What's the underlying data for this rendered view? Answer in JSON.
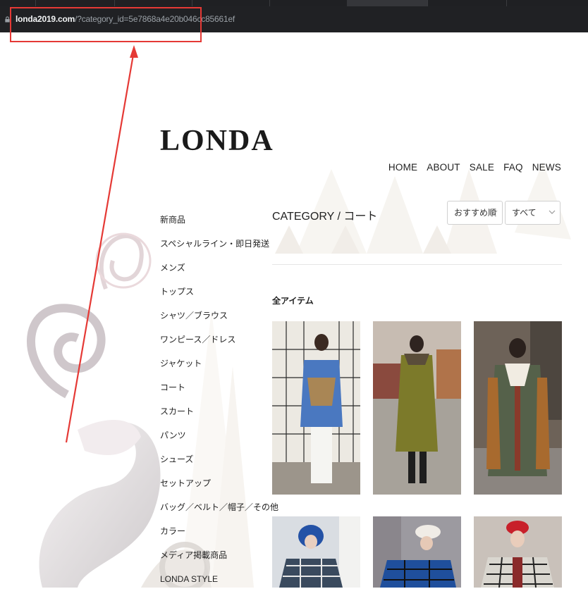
{
  "browser": {
    "url_host": "londa2019.com",
    "url_path": "/?category_id=5e7868a4e20b046cc85661ef"
  },
  "site": {
    "logo": "LONDA",
    "nav": [
      "HOME",
      "ABOUT",
      "SALE",
      "FAQ",
      "NEWS"
    ]
  },
  "sidebar": {
    "categories": [
      "新商品",
      "スペシャルライン・即日発送",
      "メンズ",
      "トップス",
      "シャツ／ブラウス",
      "ワンピース／ドレス",
      "ジャケット",
      "コート",
      "スカート",
      "パンツ",
      "シューズ",
      "セットアップ",
      "バッグ／ベルト／帽子／その他",
      "カラー",
      "メディア掲載商品",
      "LONDA STYLE"
    ]
  },
  "main": {
    "title": "CATEGORY / コート",
    "sort_select": "おすすめ順",
    "filter_select": "すべて",
    "section_title": "全アイテム"
  },
  "products": [
    {
      "coat_color": "#4a78c0",
      "bg": "#ece9e2"
    },
    {
      "coat_color": "#7c7a2a",
      "bg": "#a7a29a"
    },
    {
      "coat_color": "#55614a",
      "bg": "#6d6258"
    },
    {
      "coat_color": "#3a4a5e",
      "bg": "#d9dde2"
    },
    {
      "coat_color": "#1f4f9c",
      "bg": "#9c9aa0"
    },
    {
      "coat_color": "#d9d6cf",
      "bg": "#c9c1ba"
    }
  ],
  "colors": {
    "annotation": "#e53935",
    "chrome_dark": "#202124"
  }
}
